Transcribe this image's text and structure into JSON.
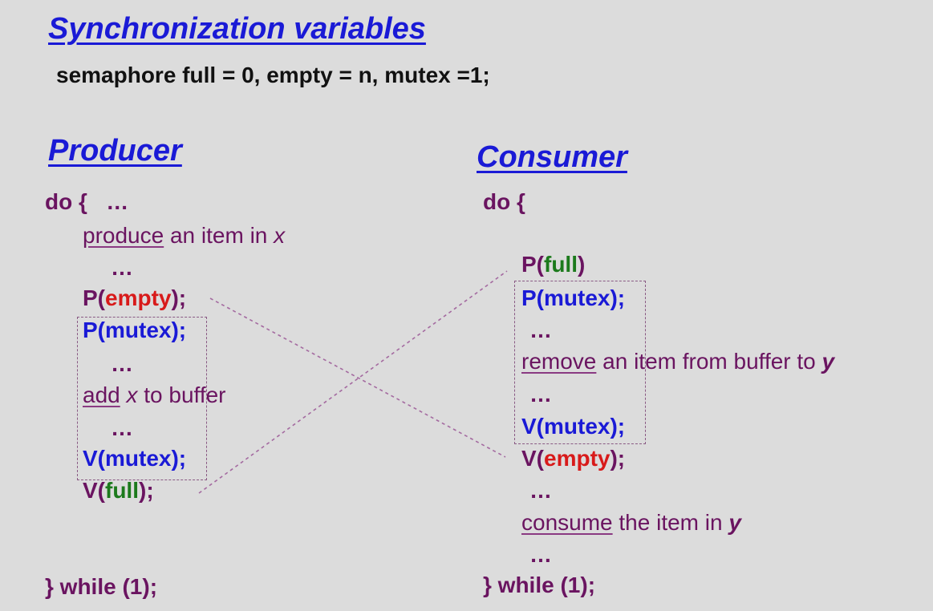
{
  "title": "Synchronization variables",
  "declaration": "semaphore full = 0, empty = n, mutex =1;",
  "producer": {
    "heading": "Producer",
    "do_open": "do {",
    "do_ellipsis": "…",
    "produce": {
      "verb": "produce",
      "rest": " an item in ",
      "var": "x"
    },
    "ellipsis": "…",
    "p_empty": {
      "op": "P(",
      "arg": "empty",
      "close": ");"
    },
    "p_mutex": "P(mutex);",
    "add": {
      "verb": "add",
      "var": "x",
      "rest": " to buffer"
    },
    "v_mutex": "V(mutex);",
    "v_full": {
      "op": "V(",
      "arg": "full",
      "close": ");"
    },
    "while": "} while (1);"
  },
  "consumer": {
    "heading": "Consumer",
    "do_open": "do {",
    "p_full": {
      "op": "P(",
      "arg": "full",
      "close": ")"
    },
    "p_mutex": "P(mutex);",
    "ellipsis": "…",
    "remove": {
      "verb": "remove",
      "rest": " an item from buffer to ",
      "var": "y"
    },
    "v_mutex": "V(mutex);",
    "v_empty": {
      "op": "V(",
      "arg": "empty",
      "close": ");"
    },
    "consume": {
      "verb": "consume",
      "rest": " the item in ",
      "var": "y"
    },
    "while": "} while (1);"
  },
  "colors": {
    "background": "#dcdcdc",
    "heading": "#1a1ad6",
    "code": "#6a1460",
    "mutex": "#1a1ad6",
    "empty": "#d81a1a",
    "full": "#1c7a1c"
  }
}
